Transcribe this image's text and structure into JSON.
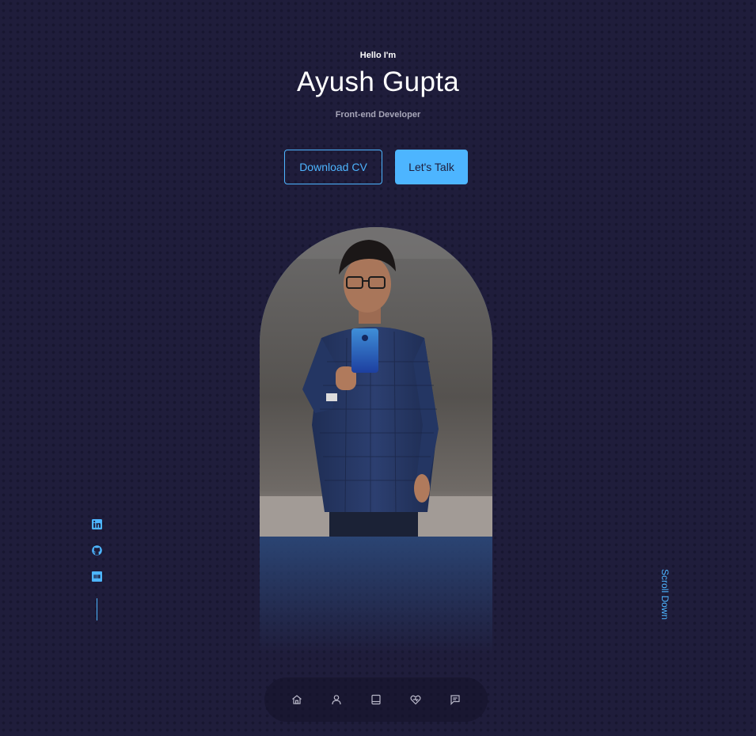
{
  "header": {
    "greeting": "Hello I'm",
    "name": "Ayush Gupta",
    "role": "Front-end Developer"
  },
  "cta": {
    "download_label": "Download CV",
    "talk_label": "Let's Talk"
  },
  "socials": [
    {
      "icon": "linkedin-icon"
    },
    {
      "icon": "github-icon"
    },
    {
      "icon": "dev-icon"
    }
  ],
  "scroll": {
    "label": "Scroll Down"
  },
  "nav": {
    "items": [
      {
        "icon": "home-icon"
      },
      {
        "icon": "user-icon"
      },
      {
        "icon": "book-icon"
      },
      {
        "icon": "services-icon"
      },
      {
        "icon": "message-icon"
      }
    ]
  },
  "colors": {
    "background": "#1f1d3b",
    "accent": "#4db5ff",
    "text": "#ffffff",
    "muted": "#a7a6b8"
  }
}
